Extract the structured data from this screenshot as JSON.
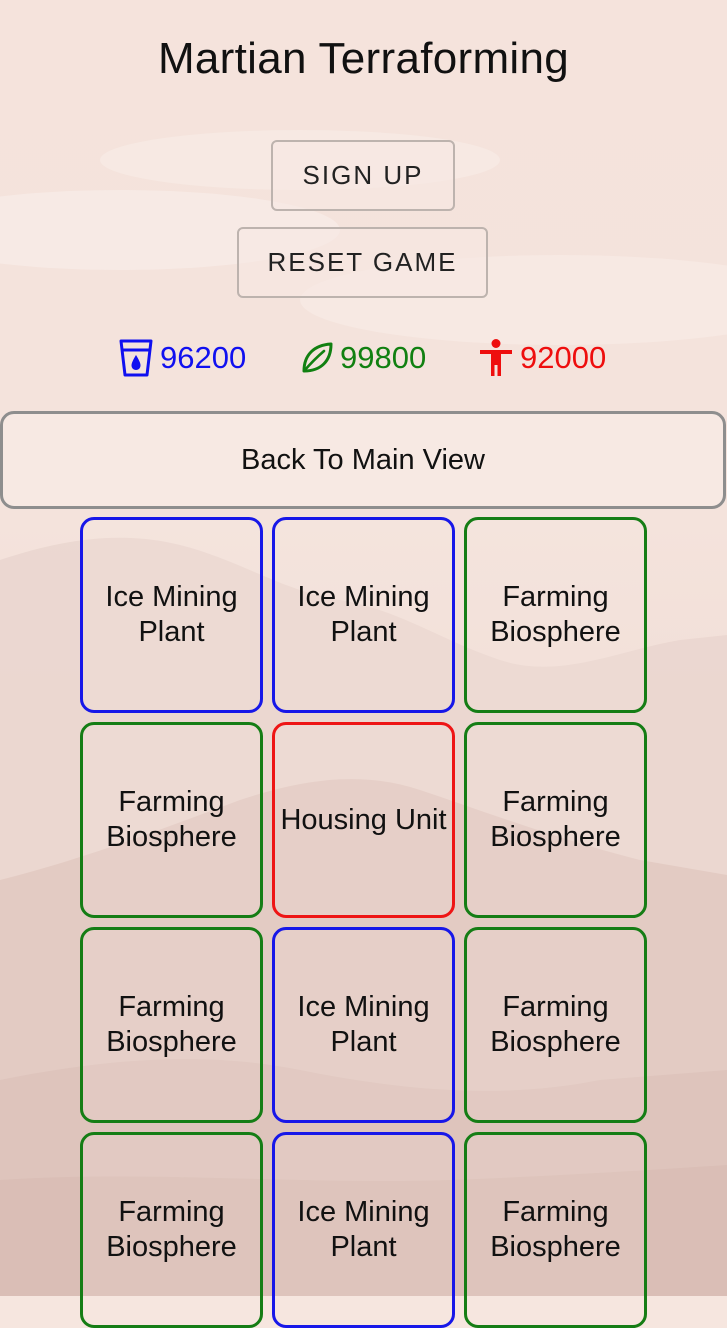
{
  "app": {
    "title": "Martian Terraforming"
  },
  "buttons": {
    "sign_up": "SIGN UP",
    "reset_game": "RESET GAME",
    "back_to_main": "Back To Main View"
  },
  "resources": {
    "water": {
      "icon": "water-glass-icon",
      "value": "96200",
      "color": "#1010f0"
    },
    "food": {
      "icon": "leaf-icon",
      "value": "99800",
      "color": "#118011"
    },
    "people": {
      "icon": "person-icon",
      "value": "92000",
      "color": "#ee0e0e"
    }
  },
  "tiles": [
    {
      "label": "Ice Mining\nPlant",
      "kind": "water"
    },
    {
      "label": "Ice Mining\nPlant",
      "kind": "water"
    },
    {
      "label": "Farming\nBiosphere",
      "kind": "food"
    },
    {
      "label": "Farming\nBiosphere",
      "kind": "food"
    },
    {
      "label": "Housing Unit",
      "kind": "housing"
    },
    {
      "label": "Farming\nBiosphere",
      "kind": "food"
    },
    {
      "label": "Farming\nBiosphere",
      "kind": "food"
    },
    {
      "label": "Ice Mining\nPlant",
      "kind": "water"
    },
    {
      "label": "Farming\nBiosphere",
      "kind": "food"
    },
    {
      "label": "Farming\nBiosphere",
      "kind": "food"
    },
    {
      "label": "Ice Mining\nPlant",
      "kind": "water"
    },
    {
      "label": "Farming\nBiosphere",
      "kind": "food"
    }
  ]
}
